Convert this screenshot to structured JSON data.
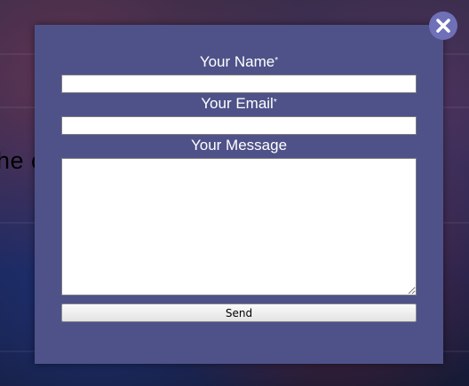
{
  "background": {
    "partial_text": "he c"
  },
  "modal": {
    "close_icon": "close-icon",
    "name_label": "Your Name",
    "email_label": "Your Email",
    "message_label": "Your Message",
    "required_mark": "*",
    "name_value": "",
    "email_value": "",
    "message_value": "",
    "send_label": "Send",
    "colors": {
      "panel": "#4e5289",
      "close_button": "#6f70b8",
      "label_text": "#ffffff"
    }
  }
}
